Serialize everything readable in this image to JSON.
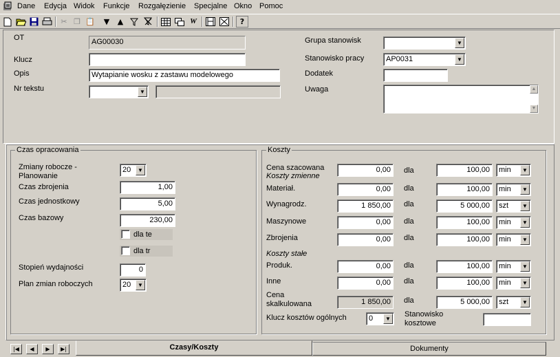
{
  "menu": [
    "Dane",
    "Edycja",
    "Widok",
    "Funkcje",
    "Rozgałęzienie",
    "Specjalne",
    "Okno",
    "Pomoc"
  ],
  "toolbar_icons": [
    "new-icon",
    "open-icon",
    "save-icon",
    "print-icon",
    "cut-icon",
    "copy-icon",
    "paste-icon",
    "down-arrow-icon",
    "up-arrow-icon",
    "filter-icon",
    "clear-filter-icon",
    "table-icon",
    "cascade-icon",
    "wordpad-icon",
    "film-icon",
    "grid-icon",
    "help-icon"
  ],
  "header": {
    "ot_label": "OT",
    "ot_value": "AG00030",
    "klucz_label": "Klucz",
    "klucz_value": "",
    "opis_label": "Opis",
    "opis_value": "Wytapianie wosku z zastawu modelowego",
    "nrtekstu_label": "Nr tekstu",
    "nrtekstu_value": "",
    "nrtekstu_extra": "",
    "grupa_label": "Grupa stanowisk",
    "grupa_value": "",
    "stanowisko_label": "Stanowisko pracy",
    "stanowisko_value": "AP0031",
    "dodatek_label": "Dodatek",
    "dodatek_value": "",
    "uwaga_label": "Uwaga",
    "uwaga_value": ""
  },
  "czas": {
    "title": "Czas opracowania",
    "zmiany_label": "Zmiany robocze -\nPlanowanie",
    "zmiany_value": "20",
    "zbrojenia_label": "Czas zbrojenia",
    "zbrojenia_value": "1,00",
    "jednostkowy_label": "Czas jednostkowy",
    "jednostkowy_value": "5,00",
    "bazowy_label": "Czas bazowy",
    "bazowy_value": "230,00",
    "dla_te_label": "dla te",
    "dla_tr_label": "dla tr",
    "stopien_label": "Stopień wydajności",
    "stopien_value": "0",
    "plan_label": "Plan zmian roboczych",
    "plan_value": "20"
  },
  "koszty": {
    "title": "Koszty",
    "dla": "dla",
    "zmienne_heading": "Koszty zmienne",
    "stale_heading": "Koszty stałe",
    "rows": [
      {
        "label": "Cena szacowana",
        "value": "0,00",
        "qty": "100,00",
        "unit": "min"
      },
      {
        "label": "Materiał.",
        "value": "0,00",
        "qty": "100,00",
        "unit": "min"
      },
      {
        "label": "Wynagrodz.",
        "value": "1 850,00",
        "qty": "5 000,00",
        "unit": "szt"
      },
      {
        "label": "Maszynowe",
        "value": "0,00",
        "qty": "100,00",
        "unit": "min"
      },
      {
        "label": "Zbrojenia",
        "value": "0,00",
        "qty": "100,00",
        "unit": "min"
      },
      {
        "label": "Produk.",
        "value": "0,00",
        "qty": "100,00",
        "unit": "min"
      },
      {
        "label": "Inne",
        "value": "0,00",
        "qty": "100,00",
        "unit": "min"
      },
      {
        "label": "Cena\nskalkulowana",
        "value": "1 850,00",
        "qty": "5 000,00",
        "unit": "szt"
      }
    ],
    "klucz_label": "Klucz kosztów ogólnych",
    "klucz_value": "0",
    "stanowisko_label": "Stanowisko\nkosztowe",
    "stanowisko_value": ""
  },
  "tabs": [
    "Czasy/Koszty",
    "Dokumenty"
  ]
}
